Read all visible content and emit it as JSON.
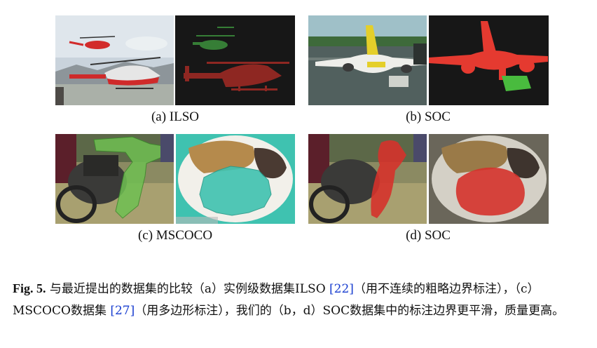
{
  "subfigures": [
    {
      "caption": "(a) ILSO"
    },
    {
      "caption": "(b) SOC"
    },
    {
      "caption": "(c) MSCOCO"
    },
    {
      "caption": "(d) SOC"
    }
  ],
  "figure_caption": {
    "label": "Fig. 5.",
    "part1": "与最近提出的数据集的比较（a）实例级数据集ILSO",
    "ref1": "[22]",
    "part2": "（用不连续的粗略边界标注），（c）MSCOCO数据集",
    "ref2": "[27]",
    "part3": "（用多边形标注），我们的（b，d）SOC数据集中的标注边界更平滑，质量更高。"
  },
  "colors": {
    "mask_red": "#d5322b",
    "mask_dark_red": "#8e2722",
    "mask_green": "#3fb23a",
    "mask_bg": "#171717",
    "coco_green": "#6fc052",
    "coco_teal": "#3fc2b0",
    "reference_link": "#1a3fd0"
  }
}
